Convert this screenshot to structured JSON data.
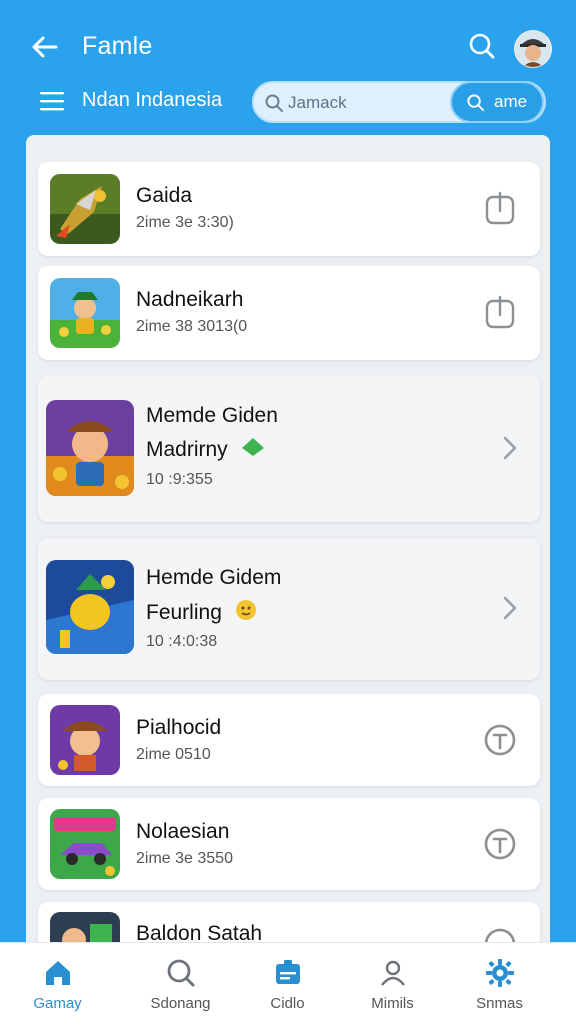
{
  "header": {
    "title": "Famle",
    "subtitle": "Ndan Indanesia",
    "search_text": "Jamack",
    "search_button": "ame"
  },
  "icons": {
    "back": "back-arrow-icon",
    "search": "search-icon",
    "menu": "hamburger-menu-icon",
    "avatar": "user-avatar"
  },
  "list": [
    {
      "name": "Gaida",
      "meta": "2ime 3e 3:30)",
      "action": "share-icon"
    },
    {
      "name": "Nadneikarh",
      "meta": "2ime 38 3013(0",
      "action": "share-icon"
    },
    {
      "name": "Memde Giden",
      "name2": "Madrirny",
      "meta": "10 :9:355",
      "action": "chevron-right-icon"
    },
    {
      "name": "Hemde Gidem",
      "name2": "Feurling",
      "meta": "10 :4:0:38",
      "action": "chevron-right-icon"
    },
    {
      "name": "Pialhocid",
      "meta": "2ime 0510",
      "action": "timer-icon"
    },
    {
      "name": "Nolaesian",
      "meta": "2ime 3e 3550",
      "action": "timer-icon"
    },
    {
      "name": "Baldon Satah",
      "meta": "",
      "action": "timer-icon"
    }
  ],
  "nav": [
    {
      "label": "Gamay",
      "icon": "home-icon"
    },
    {
      "label": "Sdonang",
      "icon": "search-icon"
    },
    {
      "label": "Cidlo",
      "icon": "id-card-icon"
    },
    {
      "label": "Mimils",
      "icon": "person-icon"
    },
    {
      "label": "Snmas",
      "icon": "gear-icon"
    }
  ],
  "colors": {
    "brand": "#2aa3ec",
    "accent": "#2a8fd0"
  }
}
